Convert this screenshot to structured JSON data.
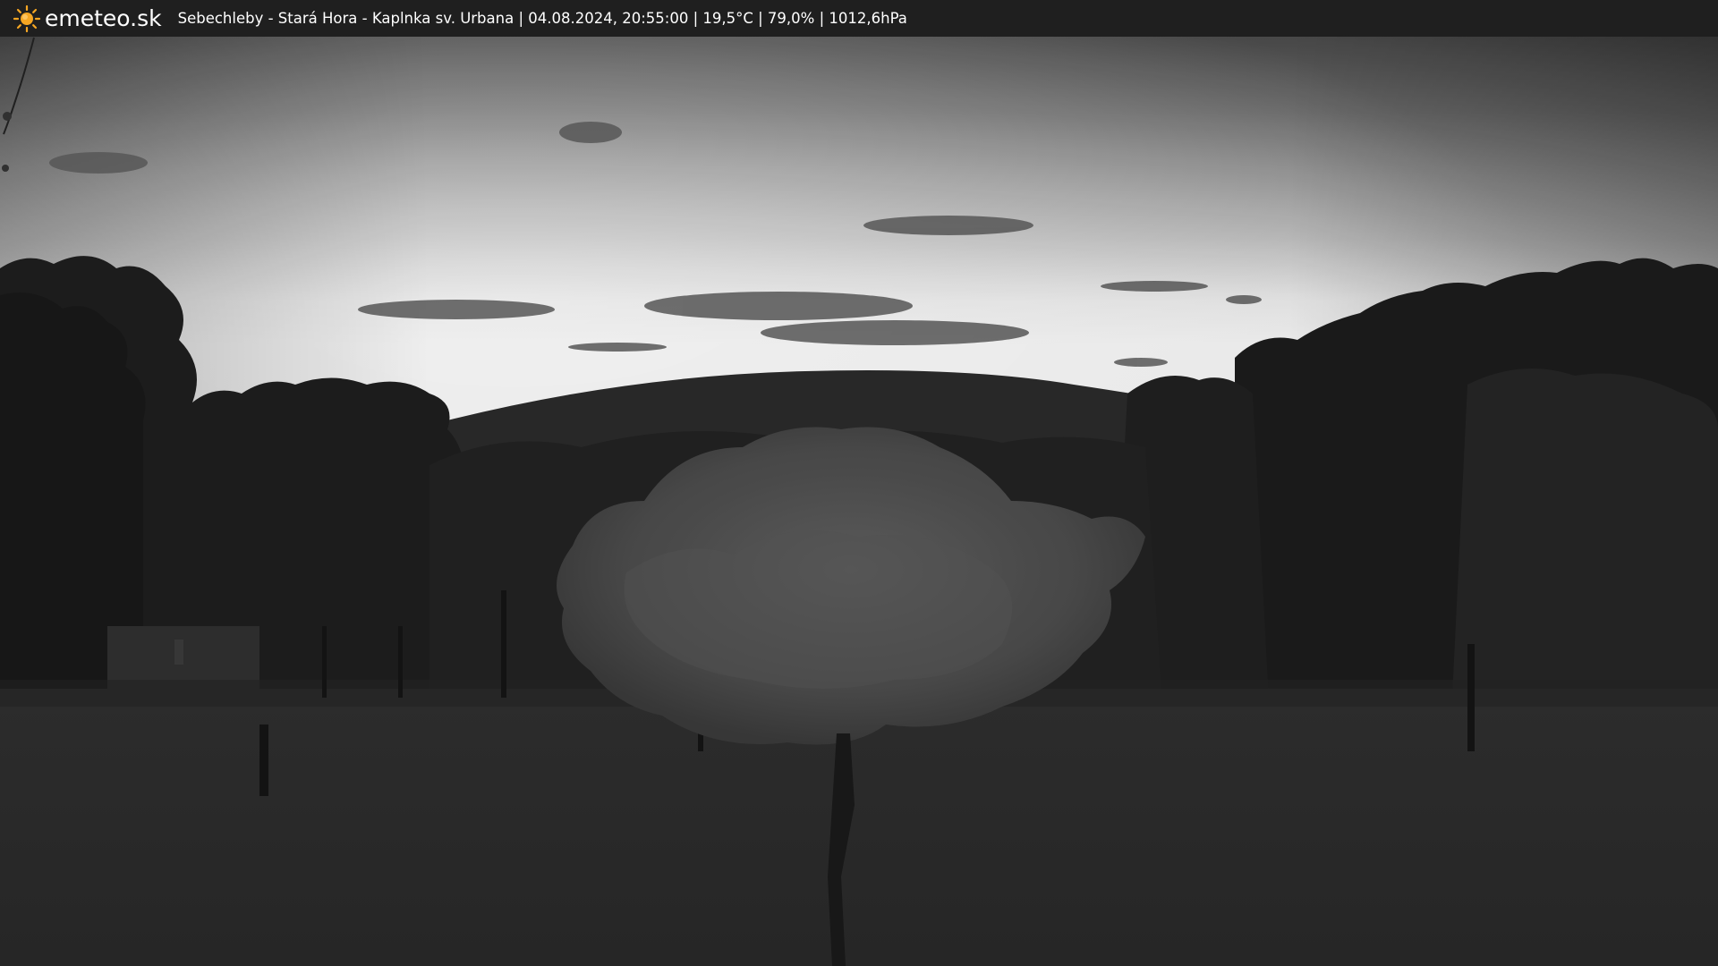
{
  "overlay": {
    "brand": "emeteo.sk",
    "logo_icon": "sun-icon",
    "caption": "Sebechleby - Stará Hora - Kaplnka sv. Urbana | 04.08.2024, 20:55:00 | 19,5°C | 79,0% | 1012,6hPa"
  },
  "colors": {
    "bar_background": "#1f1f1f",
    "bar_text": "#ffffff",
    "sun": "#f5a623"
  }
}
